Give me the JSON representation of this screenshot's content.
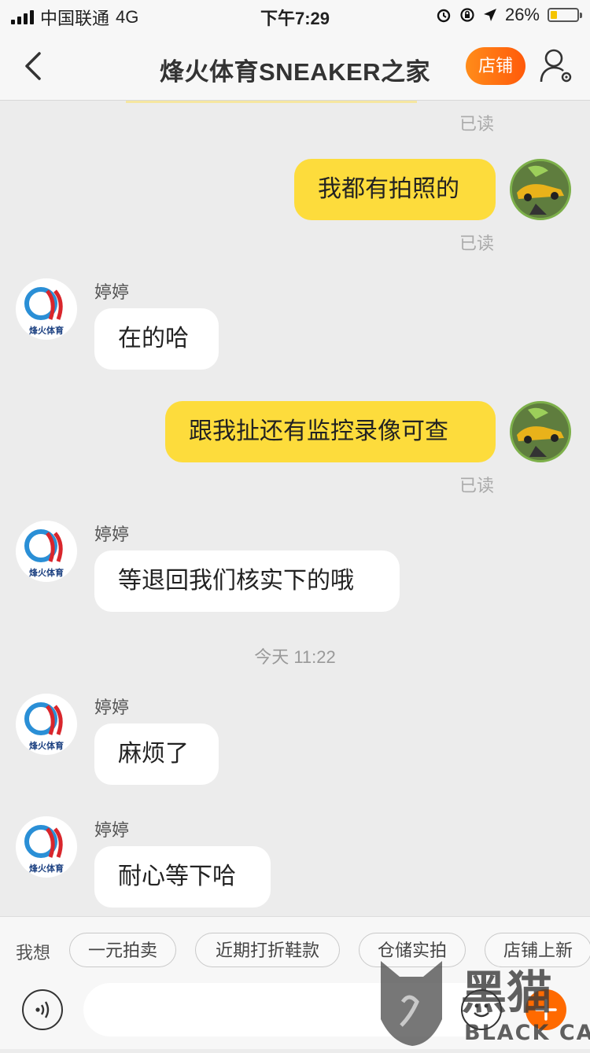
{
  "status_bar": {
    "carrier": "中国联通",
    "network": "4G",
    "time": "下午7:29",
    "battery": "26%",
    "battery_level": 0.26
  },
  "header": {
    "title": "烽火体育SNEAKER之家",
    "shop_button": "店铺"
  },
  "messages": {
    "read_top": "已读",
    "m1": {
      "text": "我都有拍照的",
      "status": "已读"
    },
    "m2": {
      "sender": "婷婷",
      "text": "在的哈"
    },
    "m3": {
      "text": "跟我扯还有监控录像可查",
      "status": "已读"
    },
    "m4": {
      "sender": "婷婷",
      "text": "等退回我们核实下的哦"
    },
    "timestamp": "今天 11:22",
    "m5": {
      "sender": "婷婷",
      "text": "麻烦了"
    },
    "m6": {
      "sender": "婷婷",
      "text": "耐心等下哈"
    }
  },
  "shop_avatar_text": "烽火体育",
  "quick_replies": {
    "label": "我想",
    "chips": [
      "一元拍卖",
      "近期打折鞋款",
      "仓储实拍",
      "店铺上新"
    ]
  },
  "watermark": {
    "cn": "黑猫",
    "en": "BLACK CAT"
  },
  "colors": {
    "my_bubble": "#fddc3c",
    "their_bubble": "#ffffff",
    "shop_button": "#ff6a00",
    "chat_bg": "#ececec"
  }
}
